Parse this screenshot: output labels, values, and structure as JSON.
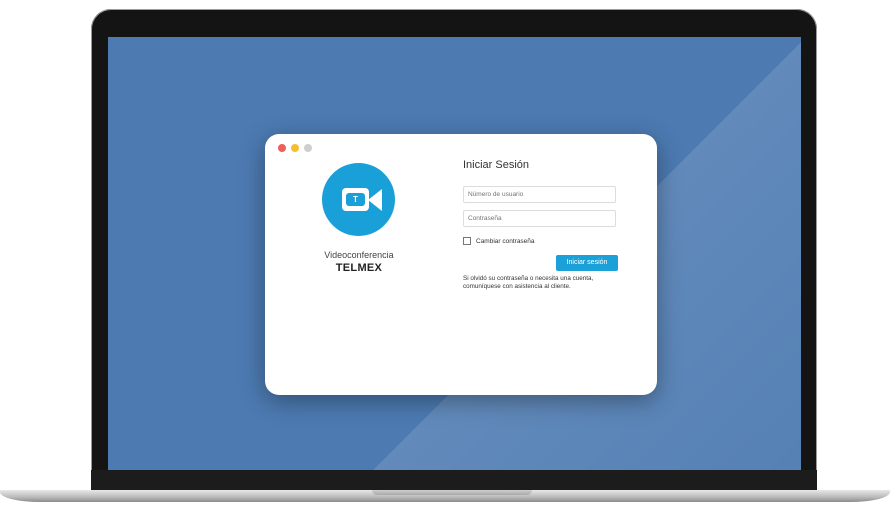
{
  "brand": {
    "subtitle": "Videoconferencia",
    "name": "TELMEX",
    "logo_mark": "telmex-t-logo",
    "accent_color": "#1aa0d8"
  },
  "window": {
    "controls": [
      "close",
      "minimize",
      "zoom"
    ]
  },
  "login": {
    "title": "Iniciar Sesión",
    "username_placeholder": "Número de usuario",
    "password_placeholder": "Contraseña",
    "change_password_label": "Cambiar contraseña",
    "change_password_checked": false,
    "submit_label": "Iniciar sesión",
    "help_line1": "Si olvidó su contraseña o necesita una cuenta,",
    "help_line2": "comuníquese con asistencia al cliente."
  },
  "colors": {
    "desktop": "#4c7ab1",
    "button": "#1ba1d8",
    "close": "#ee5f57",
    "minimize": "#f5bd2f",
    "zoom_disabled": "#cfcfcf"
  }
}
